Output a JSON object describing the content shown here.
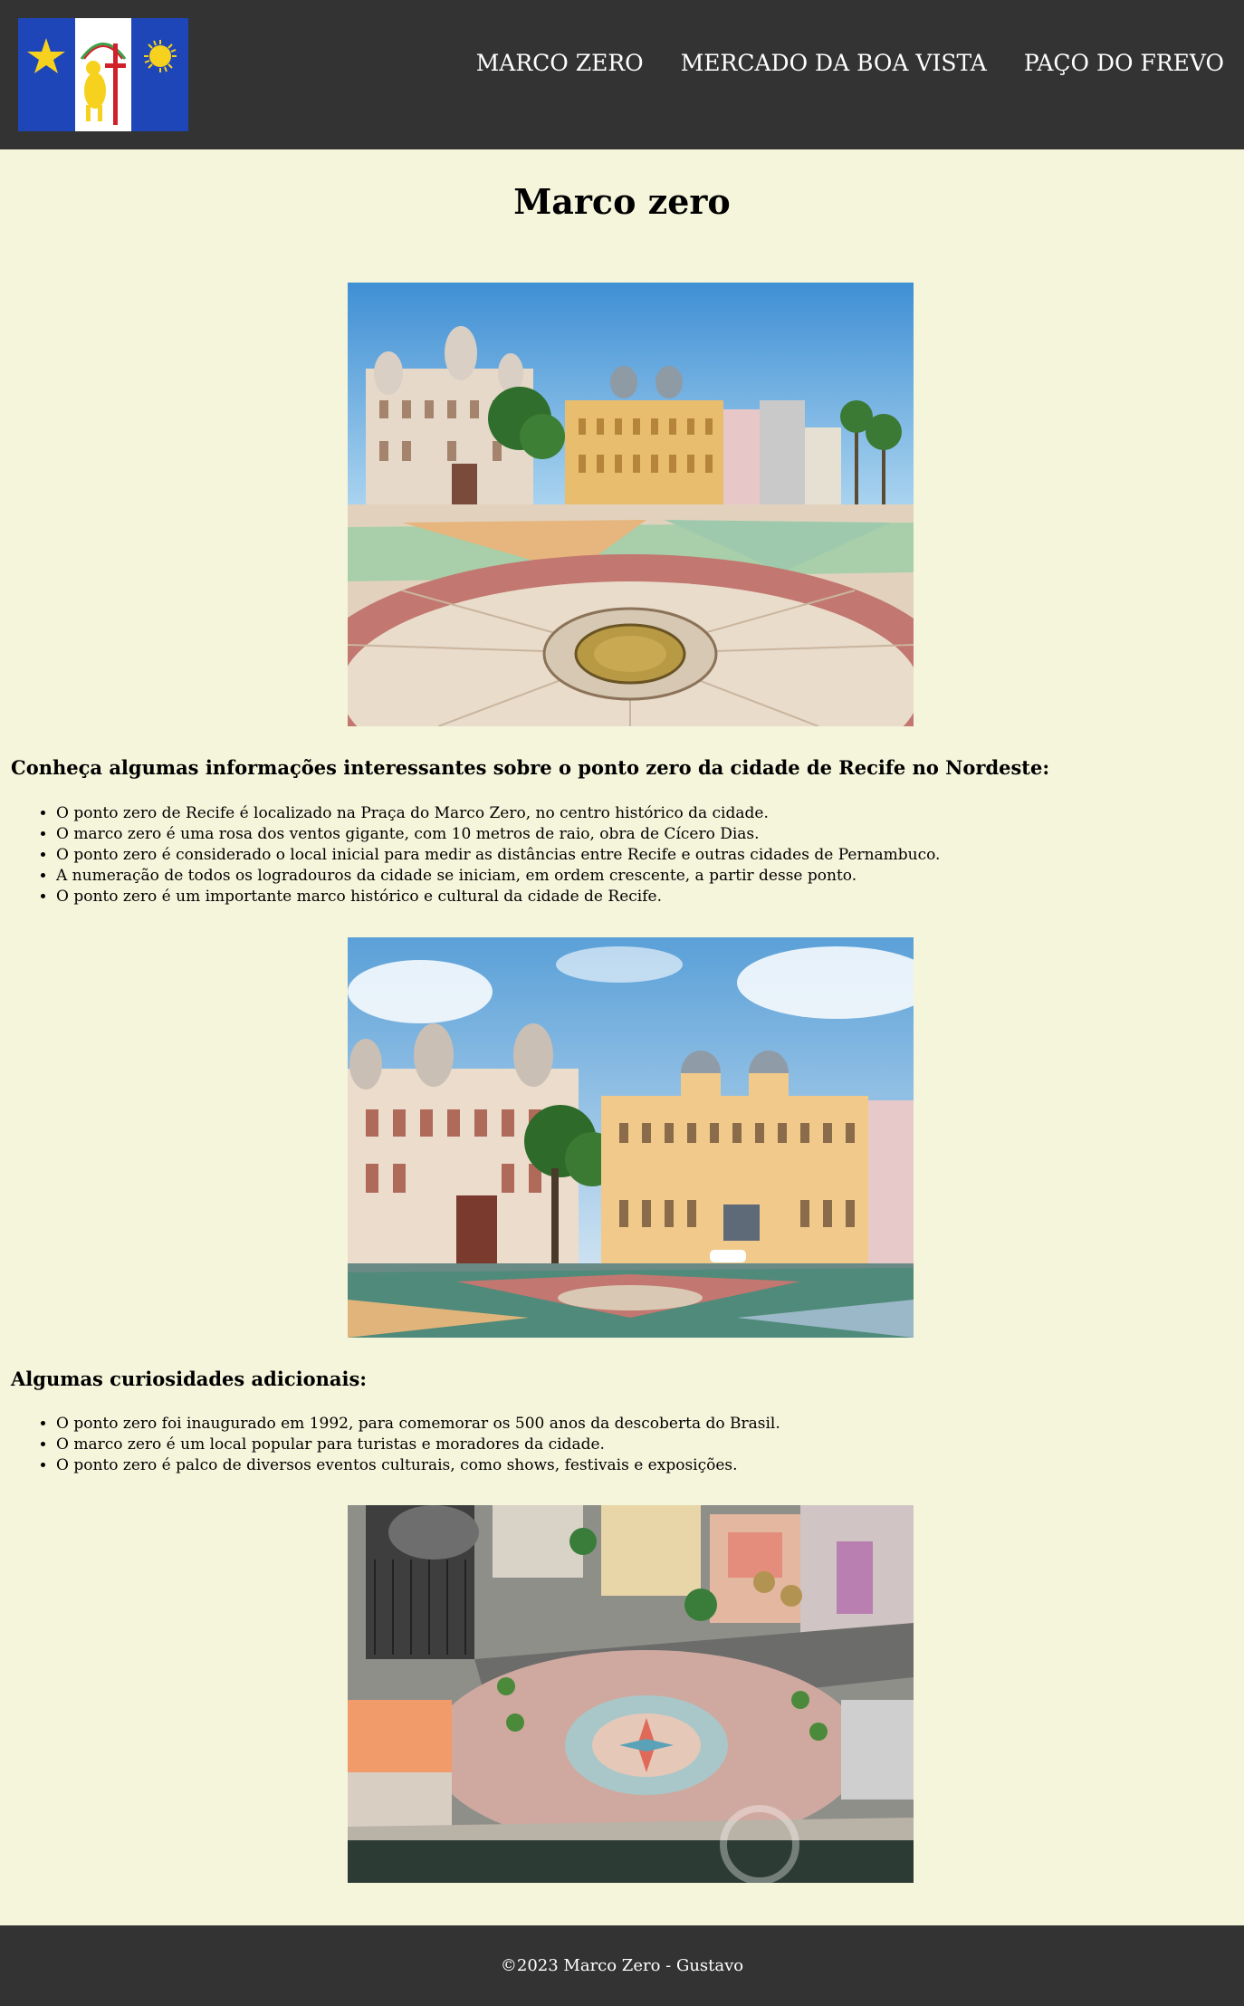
{
  "header": {
    "logo_alt": "Bandeira de Pernambuco",
    "nav": [
      {
        "label": "MARCO ZERO"
      },
      {
        "label": "MERCADO DA BOA VISTA"
      },
      {
        "label": "PAÇO DO FREVO"
      }
    ]
  },
  "main": {
    "title": "Marco zero",
    "section1": {
      "heading": "Conheça algumas informações interessantes sobre o ponto zero da cidade de Recife no Nordeste:",
      "items": [
        "O ponto zero de Recife é localizado na Praça do Marco Zero, no centro histórico da cidade.",
        "O marco zero é uma rosa dos ventos gigante, com 10 metros de raio, obra de Cícero Dias.",
        "O ponto zero é considerado o local inicial para medir as distâncias entre Recife e outras cidades de Pernambuco.",
        "A numeração de todos os logradouros da cidade se iniciam, em ordem crescente, a partir desse ponto.",
        "O ponto zero é um importante marco histórico e cultural da cidade de Recife."
      ]
    },
    "section2": {
      "heading": "Algumas curiosidades adicionais:",
      "items": [
        "O ponto zero foi inaugurado em 1992, para comemorar os 500 anos da descoberta do Brasil.",
        "O marco zero é um local popular para turistas e moradores da cidade.",
        "O ponto zero é palco de diversos eventos culturais, como shows, festivais e exposições."
      ]
    }
  },
  "footer": {
    "text": "©2023 Marco Zero - Gustavo"
  },
  "colors": {
    "header_bg": "#333333",
    "page_bg": "#f5f5dc",
    "flag_blue": "#1f46b8",
    "flag_gold": "#f6d21e",
    "flag_red": "#d0202a"
  }
}
